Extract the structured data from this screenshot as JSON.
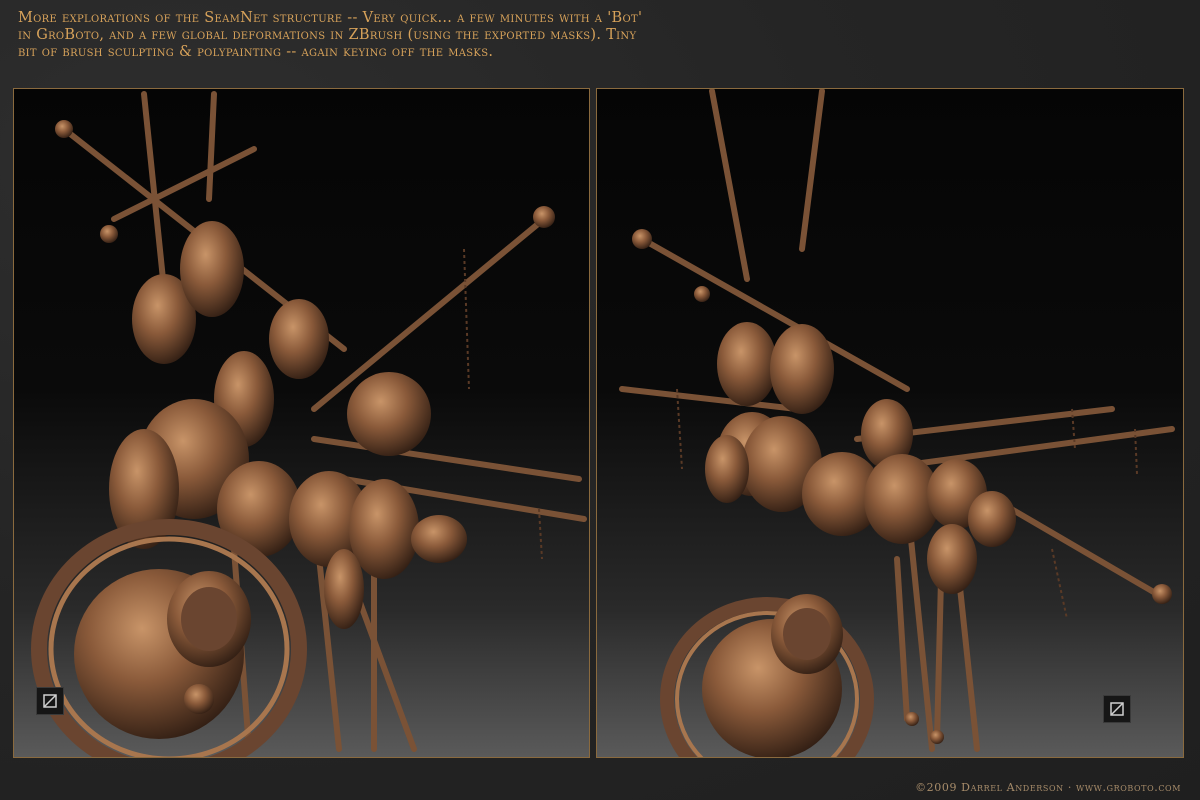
{
  "caption": "More explorations of the SeamNet structure -- Very quick... a few minutes with a 'Bot'\nin GroBoto, and a few global deformations in ZBrush (using the exported masks). Tiny\nbit of brush sculpting & polypainting -- again keying off the masks.",
  "footer": "©2009 Darrel Anderson · www.groboto.com",
  "colors": {
    "caption": "#d7a25a",
    "frame": "#8a6a3e",
    "bronze_light": "#c08858",
    "bronze_mid": "#8a5a3a",
    "bronze_dark": "#3a2418"
  },
  "panels": [
    {
      "name": "left-render",
      "badge_icon": "zbrush-logo-icon"
    },
    {
      "name": "right-render",
      "badge_icon": "zbrush-logo-icon"
    }
  ]
}
